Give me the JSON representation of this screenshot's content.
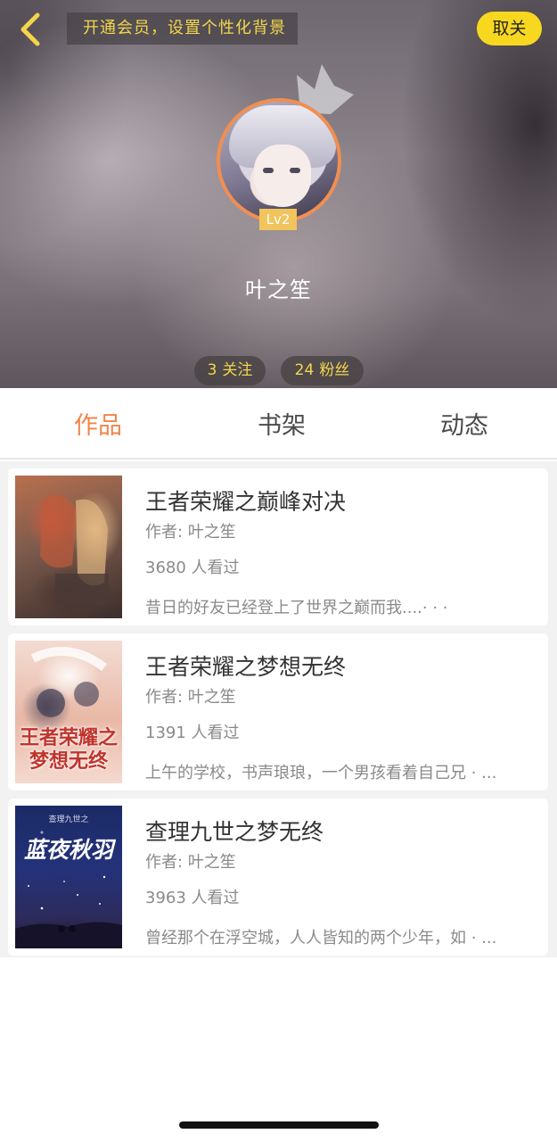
{
  "header": {
    "vip_banner": "开通会员，设置个性化背景",
    "unfollow_label": "取关",
    "level": "Lv2",
    "username": "叶之笙",
    "following": {
      "count": "3",
      "label": "关注"
    },
    "fans": {
      "count": "24",
      "label": "粉丝"
    }
  },
  "tabs": [
    {
      "label": "作品",
      "active": true
    },
    {
      "label": "书架",
      "active": false
    },
    {
      "label": "动态",
      "active": false
    }
  ],
  "works": [
    {
      "title": "王者荣耀之巅峰对决",
      "author": "作者: 叶之笙",
      "views": "3680 人看过",
      "desc": "昔日的好友已经登上了世界之巅而我....· · ·",
      "cover_text": ""
    },
    {
      "title": "王者荣耀之梦想无终",
      "author": "作者: 叶之笙",
      "views": "1391 人看过",
      "desc": "上午的学校，书声琅琅，一个男孩看着自己兄 · ...",
      "cover_text": "王者荣耀之梦想无终"
    },
    {
      "title": "查理九世之梦无终",
      "author": "作者: 叶之笙",
      "views": "3963 人看过",
      "desc": "曾经那个在浮空城，人人皆知的两个少年，如 · ...",
      "cover_sub": "查理九世之",
      "cover_text": "蓝夜秋羽"
    }
  ],
  "colors": {
    "accent_orange": "#f0854a",
    "gold_text": "#f3d54c",
    "unfollow_yellow": "#f8d81f"
  },
  "icons": {
    "back": "chevron-left-icon",
    "crown": "crown-icon"
  }
}
